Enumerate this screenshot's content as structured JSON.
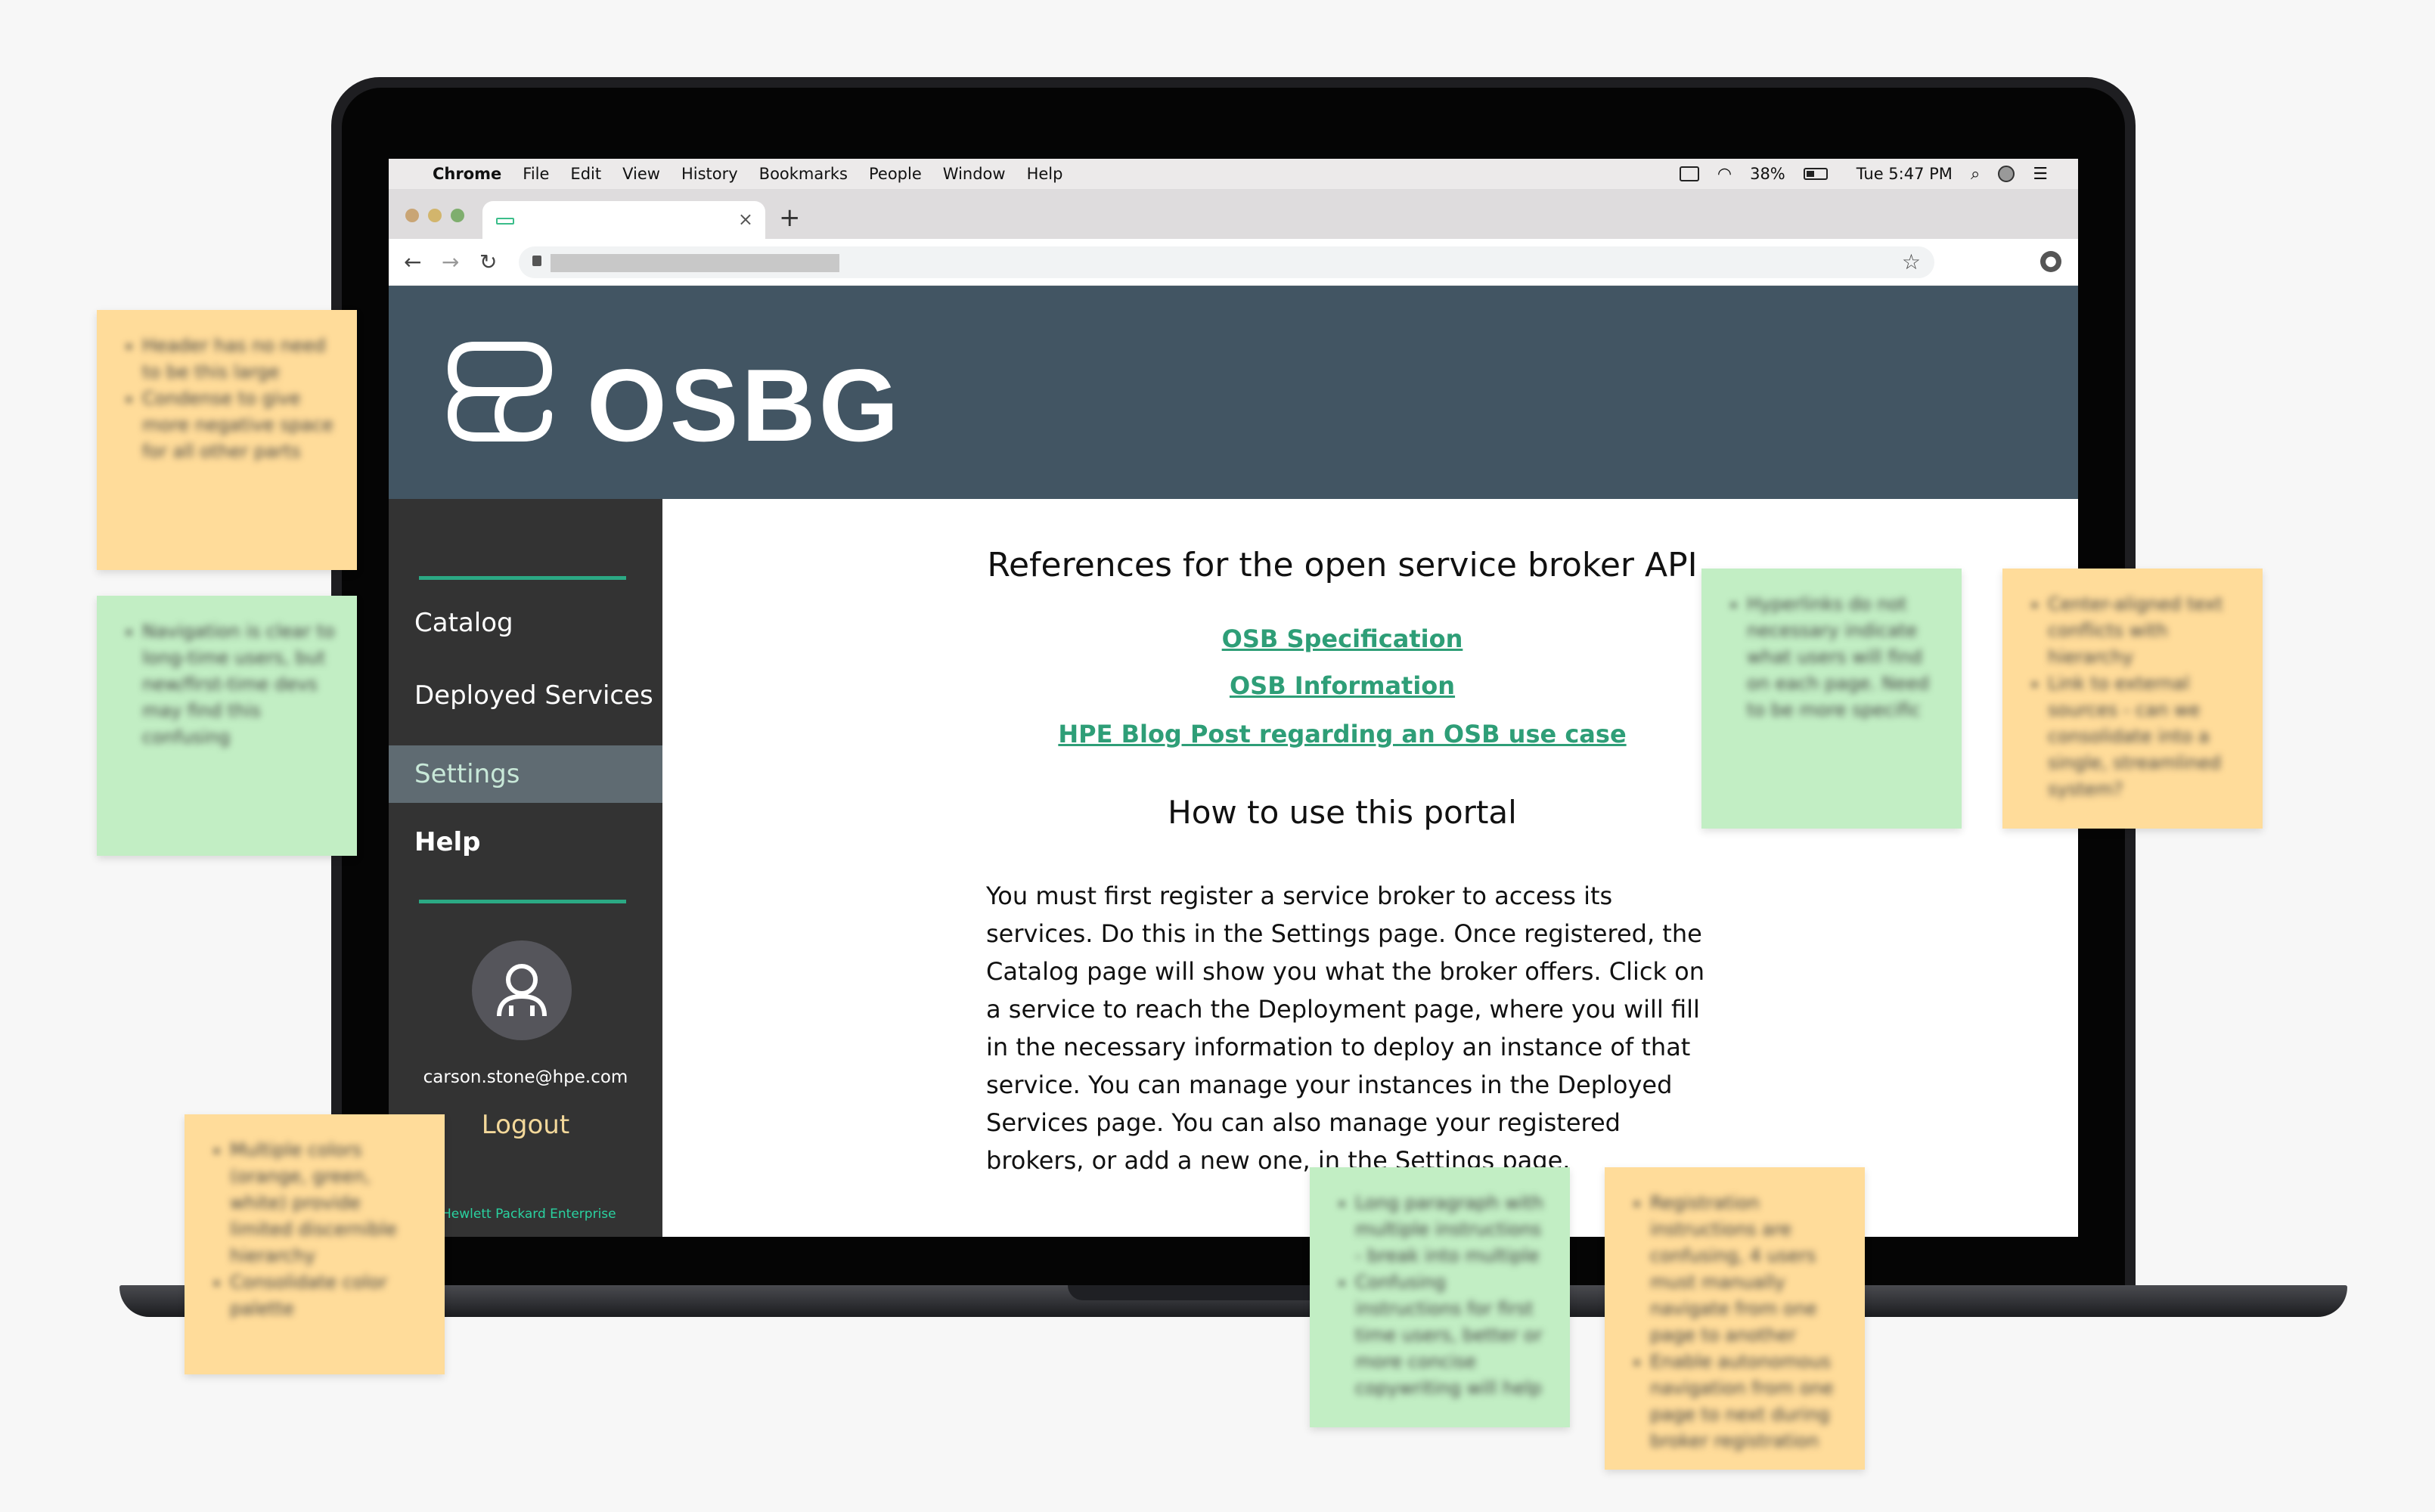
{
  "menubar": {
    "items": [
      "Chrome",
      "File",
      "Edit",
      "View",
      "History",
      "Bookmarks",
      "People",
      "Window",
      "Help"
    ],
    "battery": "38%",
    "clock": "Tue 5:47 PM"
  },
  "browser": {
    "close_tab": "×",
    "new_tab": "+",
    "back": "←",
    "forward": "→",
    "reload": "↻",
    "bookmark_star": "☆"
  },
  "app": {
    "logo_text": "OSBG",
    "accent_color": "#2ad2a0",
    "header_color": "#425563",
    "sidebar": {
      "items": [
        {
          "label": "Catalog"
        },
        {
          "label": "Deployed Services"
        },
        {
          "label": "Settings"
        },
        {
          "label": "Help"
        }
      ],
      "user_email": "carson.stone@hpe.com",
      "logout_label": "Logout",
      "footer_brand": "Hewlett Packard Enterprise"
    },
    "main": {
      "references_heading": "References for the open service broker API",
      "links": [
        "OSB Specification",
        "OSB Information",
        "HPE Blog Post regarding an OSB use case"
      ],
      "howto_heading": "How to use this portal",
      "howto_text": "You must first register a service broker to access its services. Do this in the Settings page. Once registered, the Catalog page will show you what the broker offers. Click on a service to reach the Deployment page, where you will fill in the necessary information to deploy an instance of that service. You can manage your instances in the Deployed Services page. You can also manage your registered brokers, or add a new one, in the Settings page."
    }
  },
  "notes": [
    {
      "color": "yellow",
      "lines": [
        "Header has no need to be this large",
        "Condense to give more negative space for all other parts"
      ]
    },
    {
      "color": "green",
      "lines": [
        "Navigation is clear to long-time users, but new/first-time devs may find this confusing"
      ]
    },
    {
      "color": "yellow",
      "lines": [
        "Multiple colors (orange, green, white) provide limited discernible hierarchy",
        "Consolidate color palette"
      ]
    },
    {
      "color": "green",
      "lines": [
        "Hyperlinks do not necessary indicate what users will find on each page. Need to be more specific"
      ]
    },
    {
      "color": "yellow",
      "lines": [
        "Center-aligned text conflicts with hierarchy",
        "Link to external sources - can we consolidate into a single, streamlined system?"
      ]
    },
    {
      "color": "green",
      "lines": [
        "Long paragraph with multiple instructions - break into multiple",
        "Confusing instructions for first time users, better or more concise copywriting will help"
      ]
    },
    {
      "color": "yellow",
      "lines": [
        "Registration instructions are confusing, 4 users must manually navigate from one page to another",
        "Enable autonomous navigation from one page to next during broker registration"
      ]
    }
  ]
}
